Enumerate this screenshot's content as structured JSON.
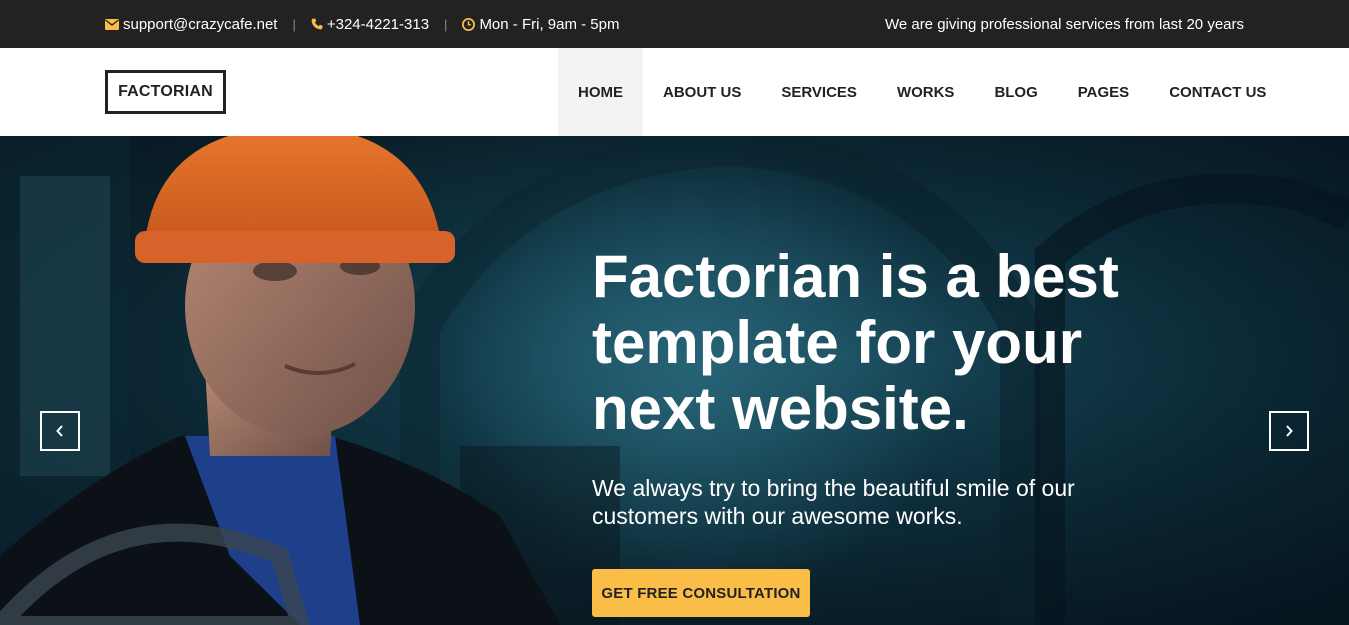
{
  "topbar": {
    "email": "support@crazycafe.net",
    "phone": "+324-4221-313",
    "hours": "Mon - Fri, 9am - 5pm",
    "separator": "|",
    "tagline": "We are giving professional services from last 20 years",
    "icon_color": "#f9bd48",
    "icons": {
      "email": "envelope-icon",
      "phone": "phone-icon",
      "hours": "clock-icon"
    }
  },
  "header": {
    "logo": "FACTORIAN",
    "nav": [
      {
        "label": "HOME",
        "active": true
      },
      {
        "label": "ABOUT US"
      },
      {
        "label": "SERVICES"
      },
      {
        "label": "WORKS"
      },
      {
        "label": "BLOG"
      },
      {
        "label": "PAGES"
      },
      {
        "label": "CONTACT US"
      }
    ]
  },
  "hero": {
    "title_lines": [
      "Factorian is a best",
      "template for your",
      "next website."
    ],
    "subtitle_lines": [
      "We always try to bring the beautiful smile of our",
      "customers with our awesome works."
    ],
    "cta_label": "GET FREE CONSULTATION",
    "prev_icon": "chevron-left-icon",
    "next_icon": "chevron-right-icon",
    "accent": "#f9bd48"
  }
}
